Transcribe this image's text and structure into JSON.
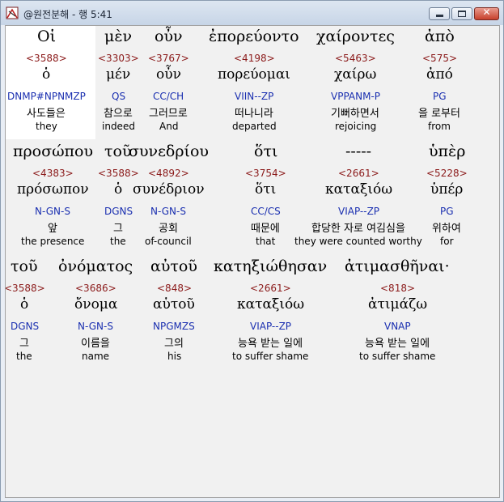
{
  "window": {
    "title": "@원전분해 - 행 5:41",
    "buttons": {
      "minimize": "minimize",
      "maximize": "maximize",
      "close": "✕"
    },
    "app_icon": "bible-icon"
  },
  "rows": [
    {
      "words": [
        {
          "greek": "Οἱ",
          "number": "<3588>",
          "lemma": "ὁ",
          "parsing": "DNMP#NPNMZP",
          "korean": "사도들은",
          "english": "they"
        },
        {
          "greek": "μὲν",
          "number": "<3303>",
          "lemma": "μέν",
          "parsing": "QS",
          "korean": "참으로",
          "english": "indeed"
        },
        {
          "greek": "οὖν",
          "number": "<3767>",
          "lemma": "οὖν",
          "parsing": "CC/CH",
          "korean": "그러므로",
          "english": "And"
        },
        {
          "greek": "ἐπορεύοντο",
          "number": "<4198>",
          "lemma": "πορεύομαι",
          "parsing": "VIIN--ZP",
          "korean": "떠나니라",
          "english": "departed"
        },
        {
          "greek": "χαίροντες",
          "number": "<5463>",
          "lemma": "χαίρω",
          "parsing": "VPPANM-P",
          "korean": "기뻐하면서",
          "english": "rejoicing"
        },
        {
          "greek": "ἀπὸ",
          "number": "<575>",
          "lemma": "ἀπό",
          "parsing": "PG",
          "korean": "을 로부터",
          "english": "from"
        }
      ]
    },
    {
      "words": [
        {
          "greek": "προσώπου",
          "number": "<4383>",
          "lemma": "πρόσωπον",
          "parsing": "N-GN-S",
          "korean": "앞",
          "english": "the presence"
        },
        {
          "greek": "τοῦ",
          "number": "<3588>",
          "lemma": "ὁ",
          "parsing": "DGNS",
          "korean": "그",
          "english": "the"
        },
        {
          "greek": "συνεδρίου",
          "number": "<4892>",
          "lemma": "συνέδριον",
          "parsing": "N-GN-S",
          "korean": "공회",
          "english": "of-council"
        },
        {
          "greek": "ὅτι",
          "number": "<3754>",
          "lemma": "ὅτι",
          "parsing": "CC/CS",
          "korean": "때문에",
          "english": "that"
        },
        {
          "greek": "-----",
          "number": "<2661>",
          "lemma": "καταξιόω",
          "parsing": "VIAP--ZP",
          "korean": "합당한 자로 여김심을",
          "english": "they were counted worthy"
        },
        {
          "greek": "ὑπὲρ",
          "number": "<5228>",
          "lemma": "ὑπέρ",
          "parsing": "PG",
          "korean": "위하여",
          "english": "for"
        }
      ]
    },
    {
      "words": [
        {
          "greek": "τοῦ",
          "number": "<3588>",
          "lemma": "ὁ",
          "parsing": "DGNS",
          "korean": "그",
          "english": "the"
        },
        {
          "greek": "ὀνόματος",
          "number": "<3686>",
          "lemma": "ὄνομα",
          "parsing": "N-GN-S",
          "korean": "이름을",
          "english": "name"
        },
        {
          "greek": "αὐτοῦ",
          "number": "<848>",
          "lemma": "αὑτοῦ",
          "parsing": "NPGMZS",
          "korean": "그의",
          "english": "his"
        },
        {
          "greek": "κατηξιώθησαν",
          "number": "<2661>",
          "lemma": "καταξιόω",
          "parsing": "VIAP--ZP",
          "korean": "능욕 받는 일에",
          "english": "to suffer shame"
        },
        {
          "greek": "ἀτιμασθῆναι·",
          "number": "<818>",
          "lemma": "ἀτιμάζω",
          "parsing": "VNAP",
          "korean": "능욕 받는 일에",
          "english": "to suffer shame"
        }
      ]
    }
  ]
}
